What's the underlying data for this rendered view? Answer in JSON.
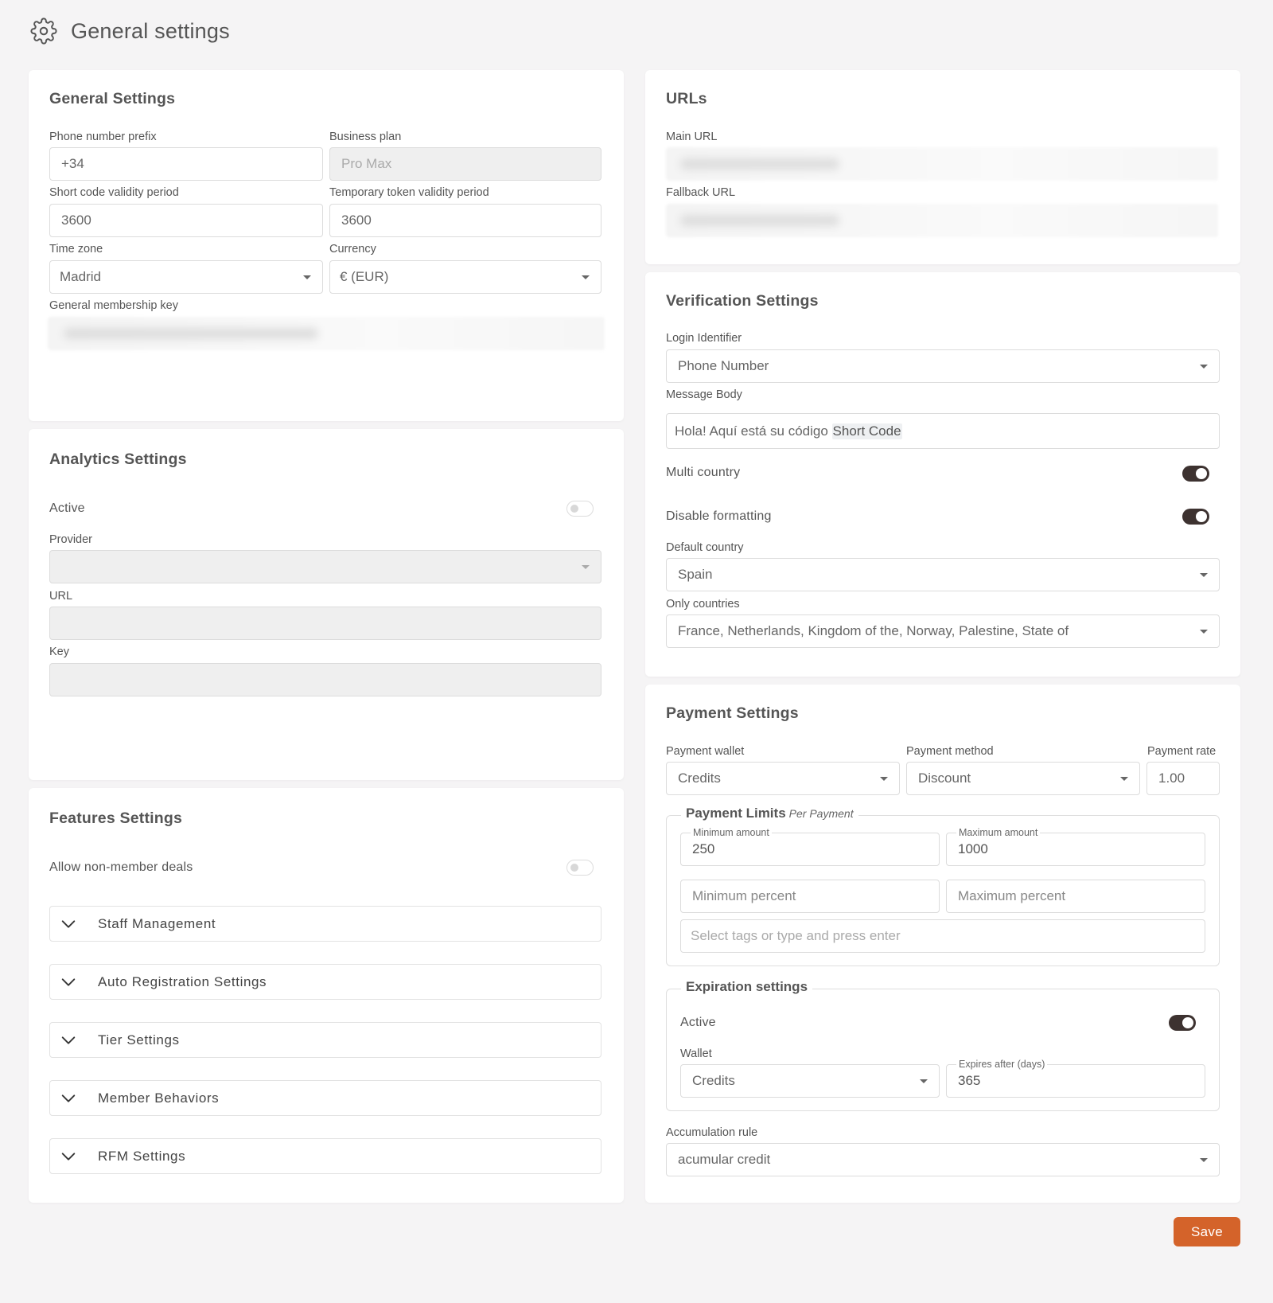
{
  "header": {
    "title": "General settings",
    "icon": "gear-icon"
  },
  "general": {
    "title": "General Settings",
    "phone_prefix_label": "Phone number prefix",
    "phone_prefix_value": "+34",
    "business_plan_label": "Business plan",
    "business_plan_value": "Pro Max",
    "short_code_label": "Short code validity period",
    "short_code_value": "3600",
    "temp_token_label": "Temporary token validity period",
    "temp_token_value": "3600",
    "timezone_label": "Time zone",
    "timezone_value": "Madrid",
    "currency_label": "Currency",
    "currency_value": "€ (EUR)",
    "membership_key_label": "General membership key"
  },
  "analytics": {
    "title": "Analytics Settings",
    "active_label": "Active",
    "active": false,
    "provider_label": "Provider",
    "url_label": "URL",
    "key_label": "Key"
  },
  "features": {
    "title": "Features Settings",
    "allow_label": "Allow non-member deals",
    "allow": false,
    "accordions": [
      "Staff Management",
      "Auto Registration Settings",
      "Tier Settings",
      "Member Behaviors",
      "RFM Settings"
    ]
  },
  "urls": {
    "title": "URLs",
    "main_label": "Main URL",
    "fallback_label": "Fallback URL"
  },
  "verification": {
    "title": "Verification Settings",
    "login_label": "Login Identifier",
    "login_value": "Phone Number",
    "message_label": "Message Body",
    "message_prefix": "Hola! Aquí está su código",
    "message_tag": "Short Code",
    "multi_country_label": "Multi country",
    "multi_country": true,
    "disable_formatting_label": "Disable formatting",
    "disable_formatting": true,
    "default_country_label": "Default country",
    "default_country_value": "Spain",
    "only_countries_label": "Only countries",
    "only_countries_value": "France, Netherlands, Kingdom of the, Norway, Palestine, State of"
  },
  "payment": {
    "title": "Payment Settings",
    "wallet_label": "Payment wallet",
    "wallet_value": "Credits",
    "method_label": "Payment method",
    "method_value": "Discount",
    "rate_label": "Payment rate",
    "rate_value": "1.00",
    "limits_title": "Payment Limits",
    "limits_sub": "Per Payment",
    "min_amount_label": "Minimum amount",
    "min_amount_value": "250",
    "max_amount_label": "Maximum amount",
    "max_amount_value": "1000",
    "min_percent_placeholder": "Minimum percent",
    "max_percent_placeholder": "Maximum percent",
    "tags_placeholder": "Select tags or type and press enter",
    "expiration_title": "Expiration settings",
    "exp_active_label": "Active",
    "exp_active": true,
    "exp_wallet_label": "Wallet",
    "exp_wallet_value": "Credits",
    "expires_label": "Expires after (days)",
    "expires_value": "365",
    "accumulation_label": "Accumulation rule",
    "accumulation_value": "acumular credit"
  },
  "actions": {
    "save_label": "Save"
  },
  "colors": {
    "accent": "#d4632a",
    "toggle_on": "#3d3230",
    "background": "#f5f4f5"
  }
}
